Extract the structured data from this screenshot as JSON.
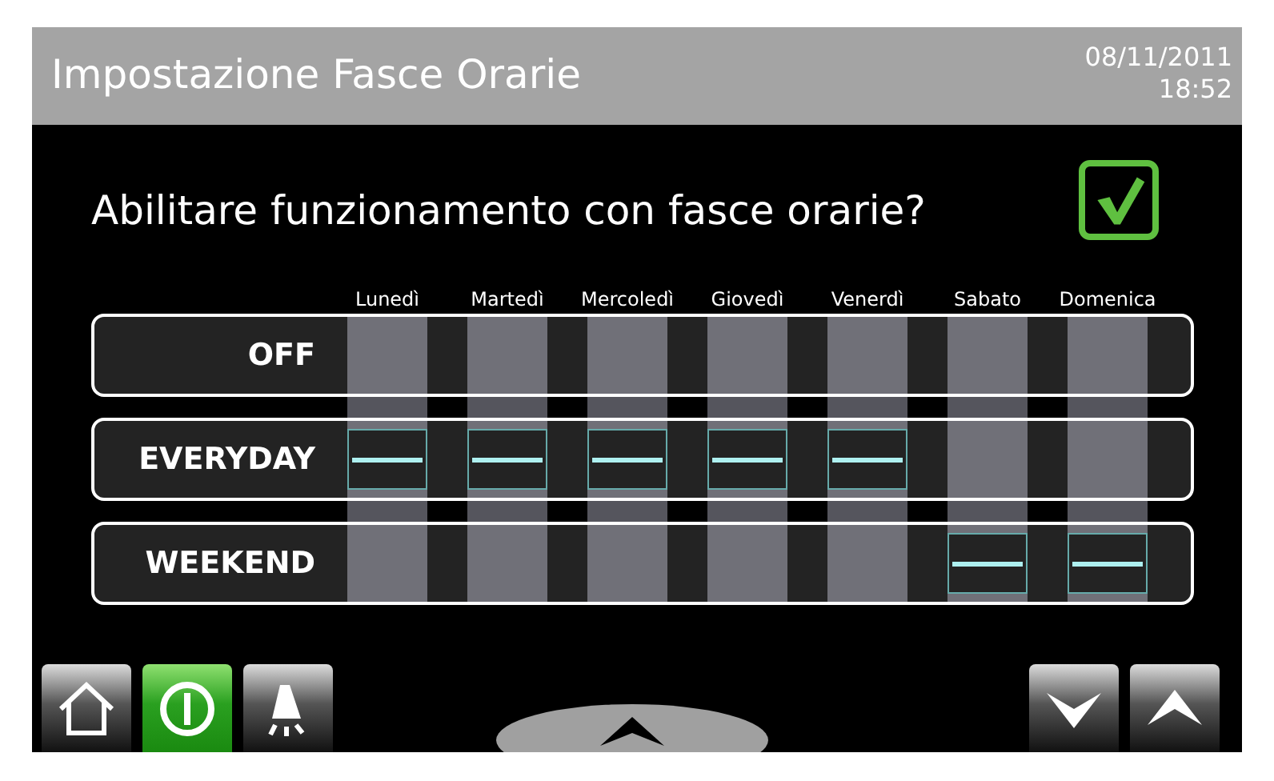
{
  "header": {
    "title": "Impostazione Fasce Orarie",
    "date": "08/11/2011",
    "time": "18:52"
  },
  "question": {
    "text": "Abilitare funzionamento con fasce orarie?",
    "checked": true
  },
  "days": [
    "Lunedì",
    "Martedì",
    "Mercoledì",
    "Giovedì",
    "Venerdì",
    "Sabato",
    "Domenica"
  ],
  "rows": [
    {
      "label": "OFF",
      "cells": [
        {
          "on": false
        },
        {
          "on": false
        },
        {
          "on": false
        },
        {
          "on": false
        },
        {
          "on": false
        },
        {
          "on": false
        },
        {
          "on": false
        }
      ]
    },
    {
      "label": "EVERYDAY",
      "cells": [
        {
          "on": true
        },
        {
          "on": true
        },
        {
          "on": true
        },
        {
          "on": true
        },
        {
          "on": true
        },
        {
          "on": false
        },
        {
          "on": false
        }
      ]
    },
    {
      "label": "WEEKEND",
      "cells": [
        {
          "on": false
        },
        {
          "on": false
        },
        {
          "on": false
        },
        {
          "on": false
        },
        {
          "on": false
        },
        {
          "on": true
        },
        {
          "on": true
        }
      ]
    }
  ],
  "toolbar": {
    "left": [
      {
        "kind": "home",
        "active": false
      },
      {
        "kind": "power",
        "active": true
      },
      {
        "kind": "bell",
        "active": false
      }
    ],
    "right": [
      {
        "kind": "down",
        "active": false
      },
      {
        "kind": "up",
        "active": false
      }
    ]
  }
}
